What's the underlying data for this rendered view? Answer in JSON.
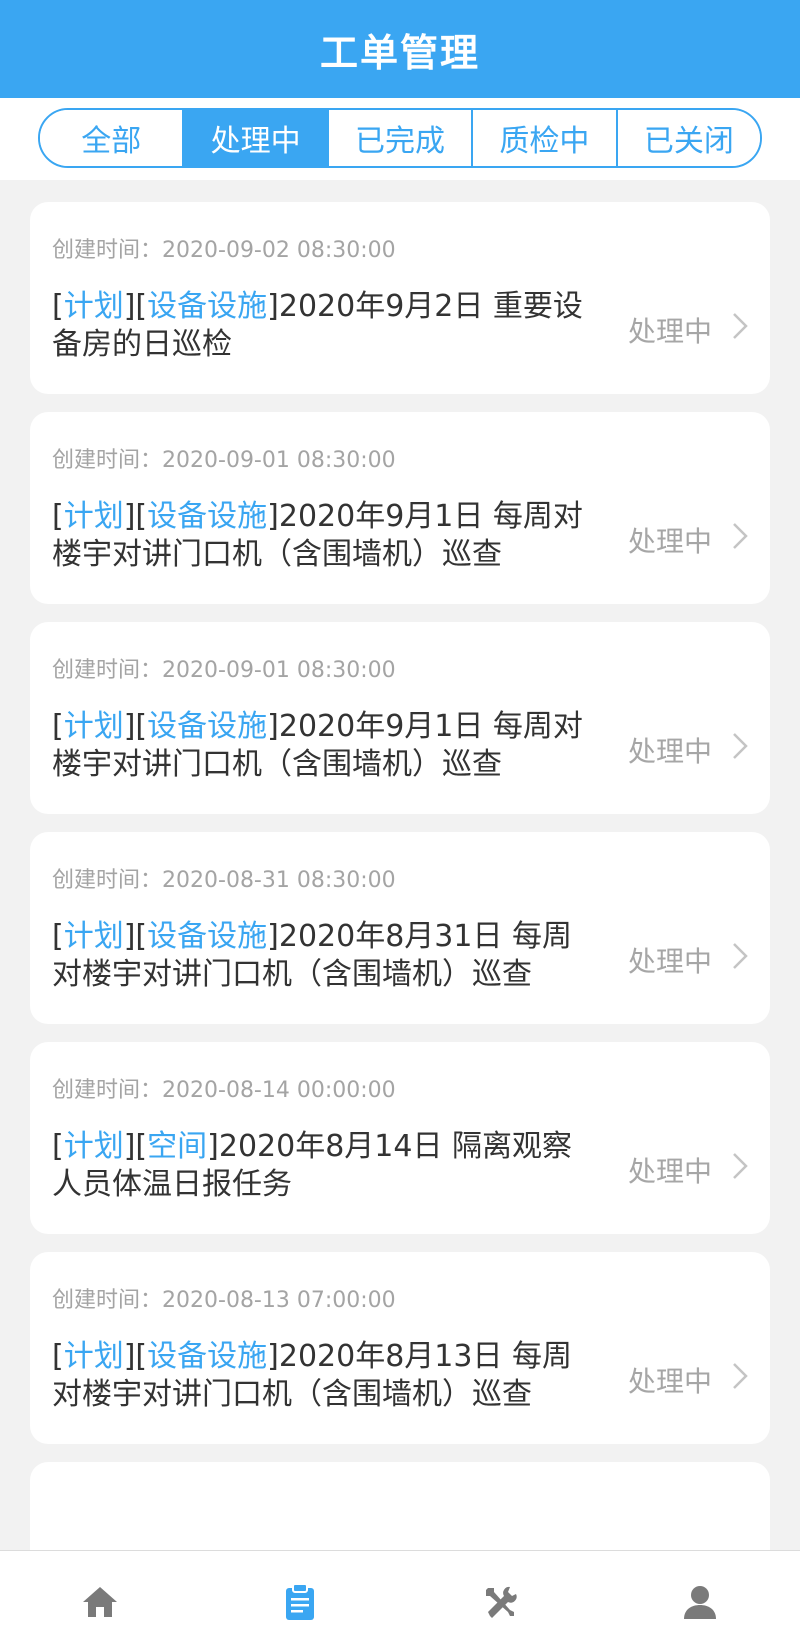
{
  "header": {
    "title": "工单管理"
  },
  "tabs": [
    {
      "label": "全部",
      "active": false
    },
    {
      "label": "处理中",
      "active": true
    },
    {
      "label": "已完成",
      "active": false
    },
    {
      "label": "质检中",
      "active": false
    },
    {
      "label": "已关闭",
      "active": false
    }
  ],
  "orders": [
    {
      "created_label": "创建时间：",
      "created_at": "2020-09-02 08:30:00",
      "tag1": "计划",
      "tag2": "设备设施",
      "title_text": "2020年9月2日 重要设备房的日巡检",
      "status": "处理中"
    },
    {
      "created_label": "创建时间：",
      "created_at": "2020-09-01 08:30:00",
      "tag1": "计划",
      "tag2": "设备设施",
      "title_text": "2020年9月1日 每周对楼宇对讲门口机（含围墙机）巡查",
      "status": "处理中"
    },
    {
      "created_label": "创建时间：",
      "created_at": "2020-09-01 08:30:00",
      "tag1": "计划",
      "tag2": "设备设施",
      "title_text": "2020年9月1日 每周对楼宇对讲门口机（含围墙机）巡查",
      "status": "处理中"
    },
    {
      "created_label": "创建时间：",
      "created_at": "2020-08-31 08:30:00",
      "tag1": "计划",
      "tag2": "设备设施",
      "title_text": "2020年8月31日 每周对楼宇对讲门口机（含围墙机）巡查",
      "status": "处理中"
    },
    {
      "created_label": "创建时间：",
      "created_at": "2020-08-14 00:00:00",
      "tag1": "计划",
      "tag2": "空间",
      "title_text": "2020年8月14日 隔离观察人员体温日报任务",
      "status": "处理中"
    },
    {
      "created_label": "创建时间：",
      "created_at": "2020-08-13 07:00:00",
      "tag1": "计划",
      "tag2": "设备设施",
      "title_text": "2020年8月13日 每周对楼宇对讲门口机（含围墙机）巡查",
      "status": "处理中"
    }
  ],
  "bottom_nav": [
    {
      "icon": "home-icon",
      "active": false
    },
    {
      "icon": "clipboard-icon",
      "active": true
    },
    {
      "icon": "tools-icon",
      "active": false
    },
    {
      "icon": "user-icon",
      "active": false
    }
  ],
  "colors": {
    "accent": "#3aa6f2",
    "muted": "#a6a6a6",
    "nav_inactive": "#7a7a7a"
  }
}
